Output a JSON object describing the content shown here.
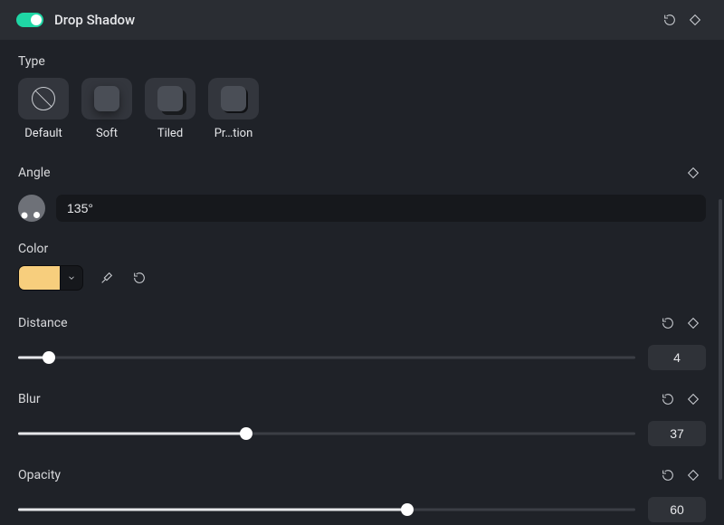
{
  "header": {
    "title": "Drop Shadow",
    "enabled": true
  },
  "type": {
    "label": "Type",
    "options": [
      {
        "id": "default",
        "label": "Default"
      },
      {
        "id": "soft",
        "label": "Soft"
      },
      {
        "id": "tiled",
        "label": "Tiled"
      },
      {
        "id": "projection",
        "label": "Pr…tion"
      }
    ],
    "selected": "default"
  },
  "angle": {
    "label": "Angle",
    "value": "135°"
  },
  "color": {
    "label": "Color",
    "value": "#f7ce7d"
  },
  "sliders": {
    "distance": {
      "label": "Distance",
      "value": 4,
      "pct": 5
    },
    "blur": {
      "label": "Blur",
      "value": 37,
      "pct": 37
    },
    "opacity": {
      "label": "Opacity",
      "value": 60,
      "pct": 63
    }
  }
}
